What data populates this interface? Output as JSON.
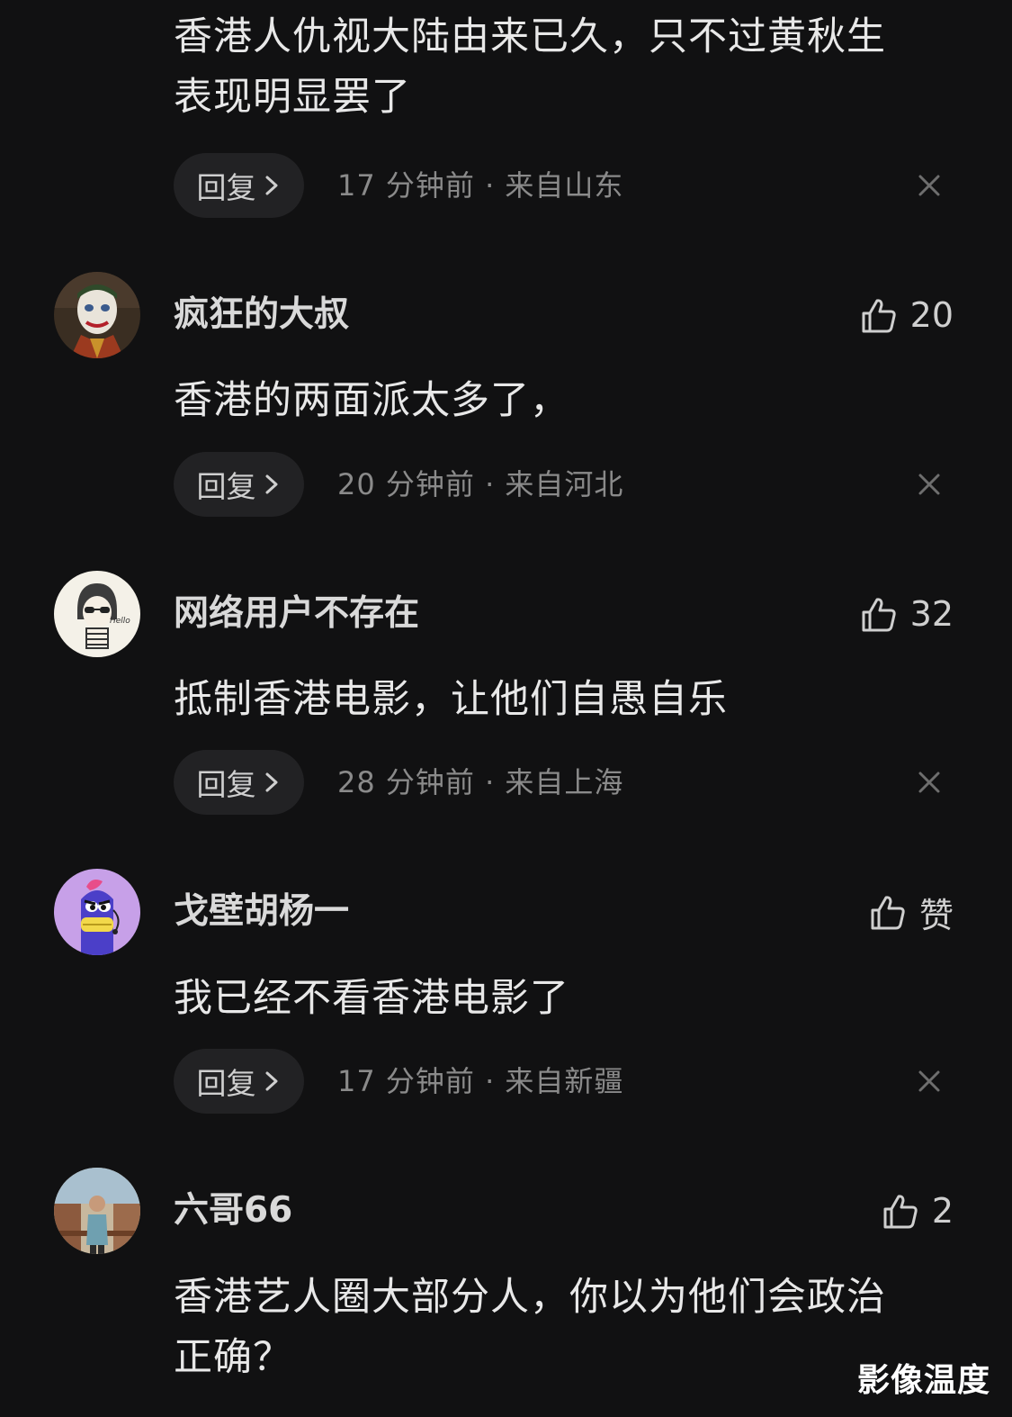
{
  "colors": {
    "background": "#111112",
    "text": "#e8e8e8",
    "meta": "#8a8a8a",
    "reply_bg": "#222224"
  },
  "top_comment": {
    "text": "香港人仇视大陆由来已久，只不过黄秋生\n表现明显罢了",
    "reply_label": "回复",
    "meta": "17 分钟前 · 来自山东"
  },
  "comments": [
    {
      "username": "疯狂的大叔",
      "likes": "20",
      "text": "香港的两面派太多了，",
      "reply_label": "回复",
      "meta": "20 分钟前 · 来自河北",
      "avatar": "joker-avatar"
    },
    {
      "username": "网络用户不存在",
      "likes": "32",
      "text": "抵制香港电影，让他们自愚自乐",
      "reply_label": "回复",
      "meta": "28 分钟前 · 来自上海",
      "avatar": "cartoon-sunglasses-avatar"
    },
    {
      "username": "戈壁胡杨一",
      "likes": "赞",
      "text": "我已经不看香港电影了",
      "reply_label": "回复",
      "meta": "17 分钟前 · 来自新疆",
      "avatar": "purple-monster-avatar"
    },
    {
      "username": "六哥66",
      "likes": "2",
      "text": "香港艺人圈大部分人，你以为他们会政治\n正确？",
      "avatar": "photo-man-avatar"
    }
  ],
  "icons": {
    "like": "thumbs-up-icon",
    "reply_chevron": "chevron-right-icon",
    "dismiss": "close-icon"
  },
  "watermark": "影像温度"
}
